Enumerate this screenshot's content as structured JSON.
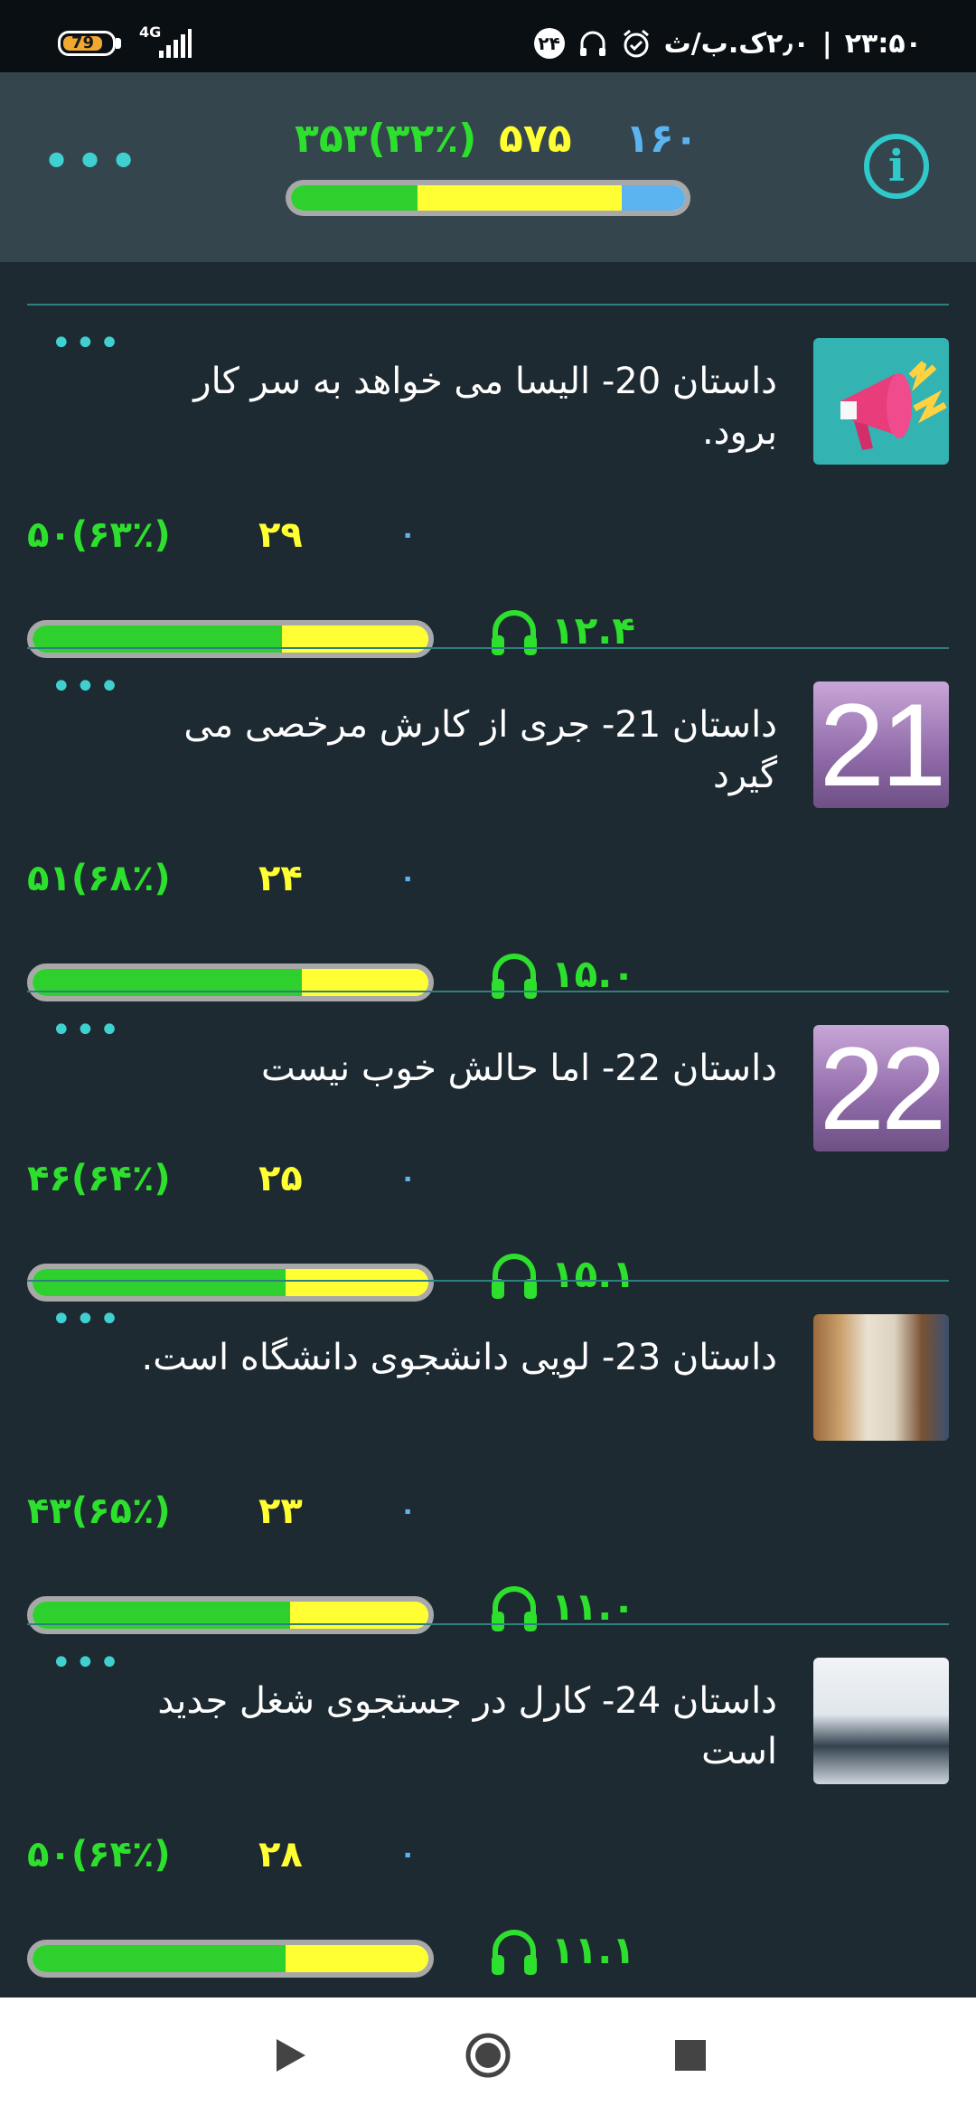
{
  "status_bar": {
    "battery": "79",
    "network": "4G",
    "time": "۲۳:۵۰",
    "separator": "|",
    "speed": "۲٫۰ک.ب/ث",
    "notification_count": "۲۴"
  },
  "header": {
    "stats": {
      "blue": "۱۶۰",
      "yellow": "۵۷۵",
      "green": "۳۵۳(۳۲٪)"
    },
    "progress": {
      "green": 0.32,
      "yellow": 0.52,
      "blue": 0.16
    }
  },
  "colors": {
    "green": "#2ee02e",
    "yellow": "#ffff33",
    "blue": "#5bb4f0",
    "accent": "#3fd0d0"
  },
  "items": [
    {
      "title": "داستان 20- الیسا می خواهد به سر کار برود.",
      "thumb": "megaphone",
      "stats": {
        "blue": "۰",
        "yellow": "۲۹",
        "green": "۵۰(۶۳٪)"
      },
      "progress": {
        "green": 0.63,
        "yellow": 0.37
      },
      "duration": "۱۲.۴"
    },
    {
      "title": "داستان 21- جری از کارش مرخصی می گیرد",
      "thumb": "21",
      "stats": {
        "blue": "۰",
        "yellow": "۲۴",
        "green": "۵۱(۶۸٪)"
      },
      "progress": {
        "green": 0.68,
        "yellow": 0.32
      },
      "duration": "۱۵.۰"
    },
    {
      "title": "داستان 22- اما حالش خوب نیست",
      "thumb": "22",
      "stats": {
        "blue": "۰",
        "yellow": "۲۵",
        "green": "۴۶(۶۴٪)"
      },
      "progress": {
        "green": 0.64,
        "yellow": 0.36
      },
      "duration": "۱۵.۱"
    },
    {
      "title": "داستان 23- لویی  دانشجوی دانشگاه است.",
      "thumb": "photo-student",
      "stats": {
        "blue": "۰",
        "yellow": "۲۳",
        "green": "۴۳(۶۵٪)"
      },
      "progress": {
        "green": 0.65,
        "yellow": 0.35
      },
      "duration": "۱۱.۰"
    },
    {
      "title": "داستان 24- کارل در جستجوی شغل جدید است",
      "thumb": "photo-meeting",
      "stats": {
        "blue": "۰",
        "yellow": "۲۸",
        "green": "۵۰(۶۴٪)"
      },
      "progress": {
        "green": 0.64,
        "yellow": 0.36
      },
      "duration": "۱۱.۱"
    }
  ]
}
